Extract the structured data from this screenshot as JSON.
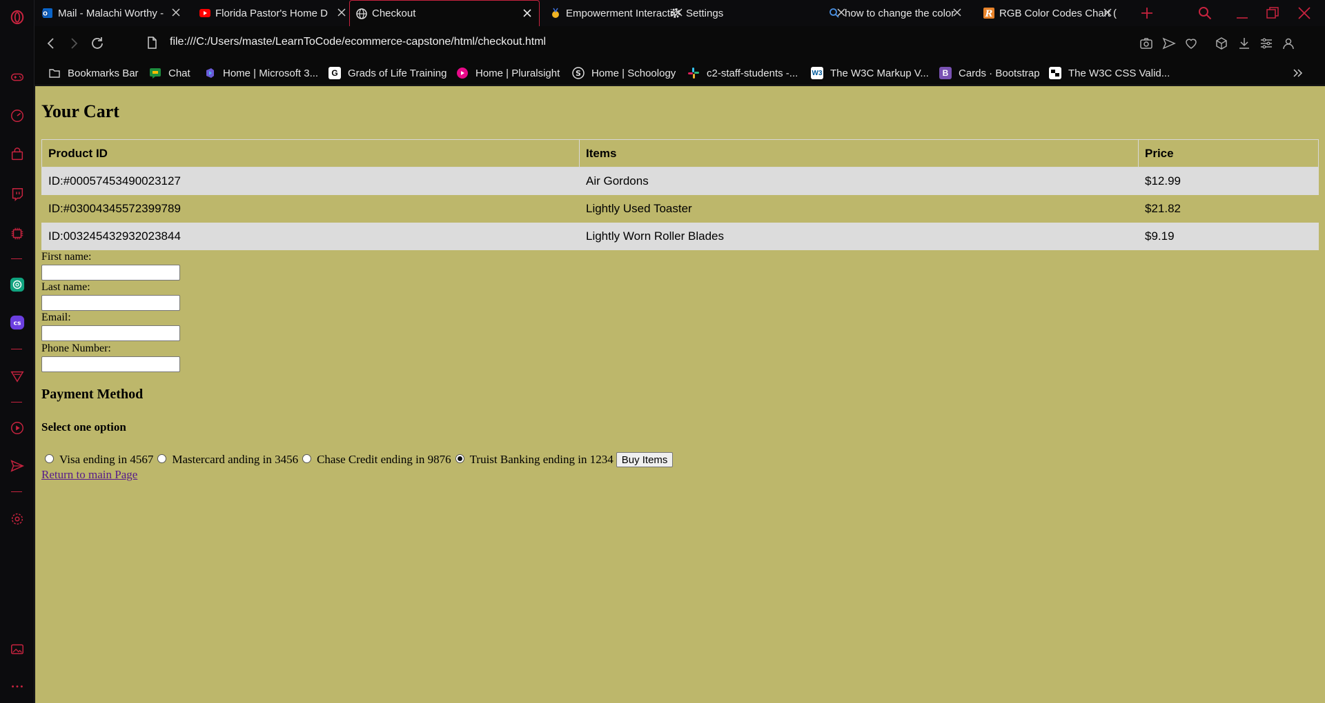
{
  "browser": {
    "tabs": [
      {
        "title": "Mail - Malachi Worthy -",
        "icon": "outlook-icon"
      },
      {
        "title": "Florida Pastor's Home D",
        "icon": "youtube-icon"
      },
      {
        "title": "Checkout",
        "icon": "globe-icon",
        "active": true
      },
      {
        "title": "Empowerment Interactiv",
        "icon": "medal-icon"
      },
      {
        "title": "Settings",
        "icon": "gear-icon"
      },
      {
        "title": "how to change the color",
        "icon": "search-icon"
      },
      {
        "title": "RGB Color Codes Chart (",
        "icon": "rapidtables-icon"
      }
    ],
    "url": "file:///C:/Users/maste/LearnToCode/ecommerce-capstone/html/checkout.html",
    "bookmarks": [
      {
        "label": "Bookmarks Bar",
        "icon": "folder-icon"
      },
      {
        "label": "Chat",
        "icon": "google-chat-icon"
      },
      {
        "label": "Home | Microsoft 3...",
        "icon": "microsoft365-icon"
      },
      {
        "label": "Grads of Life Training",
        "icon": "grads-of-life-icon"
      },
      {
        "label": "Home | Pluralsight",
        "icon": "pluralsight-icon"
      },
      {
        "label": "Home | Schoology",
        "icon": "schoology-icon"
      },
      {
        "label": "c2-staff-students -...",
        "icon": "slack-icon"
      },
      {
        "label": "The W3C Markup V...",
        "icon": "w3c-icon"
      },
      {
        "label": "Cards · Bootstrap",
        "icon": "bootstrap-icon"
      },
      {
        "label": "The W3C CSS Valid...",
        "icon": "w3c-css-icon"
      }
    ],
    "accent_color": "#c8233f"
  },
  "page": {
    "background": "#bdb76b",
    "cart_title": "Your Cart",
    "table": {
      "headers": [
        "Product ID",
        "Items",
        "Price"
      ],
      "rows": [
        [
          "ID:#00057453490023127",
          "Air Gordons",
          "$12.99"
        ],
        [
          "ID:#03004345572399789",
          "Lightly Used Toaster",
          "$21.82"
        ],
        [
          "ID:003245432932023844",
          "Lightly Worn Roller Blades",
          "$9.19"
        ]
      ]
    },
    "form": {
      "first_name_label": "First name:",
      "last_name_label": "Last name:",
      "email_label": "Email:",
      "phone_label": "Phone Number:"
    },
    "payment_title": "Payment Method",
    "payment_subtitle": "Select one option",
    "payment_options": [
      {
        "label": "Visa ending in 4567",
        "checked": false
      },
      {
        "label": "Mastercard anding in 3456",
        "checked": false
      },
      {
        "label": "Chase Credit ending in 9876",
        "checked": false
      },
      {
        "label": "Truist Banking ending in 1234",
        "checked": true
      }
    ],
    "buy_button": "Buy Items",
    "return_link": "Return to main Page"
  }
}
